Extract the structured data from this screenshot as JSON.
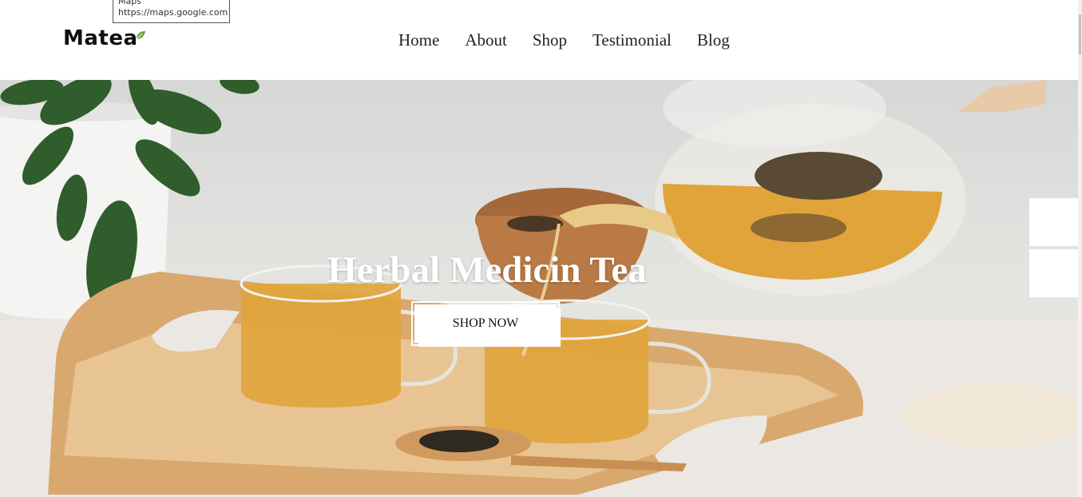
{
  "tooltip": {
    "line1": "Maps",
    "line2": "https://maps.google.com"
  },
  "header": {
    "logo": "Matea",
    "nav": [
      "Home",
      "About",
      "Shop",
      "Testimonial",
      "Blog"
    ]
  },
  "hero": {
    "title": "Herbal Medicin Tea",
    "cta": "SHOP NOW"
  },
  "colors": {
    "tea": "#e0a43a",
    "wood": "#d9a86e",
    "leaf": "#2f5d2c",
    "brand_leaf": "#5aa33a"
  }
}
